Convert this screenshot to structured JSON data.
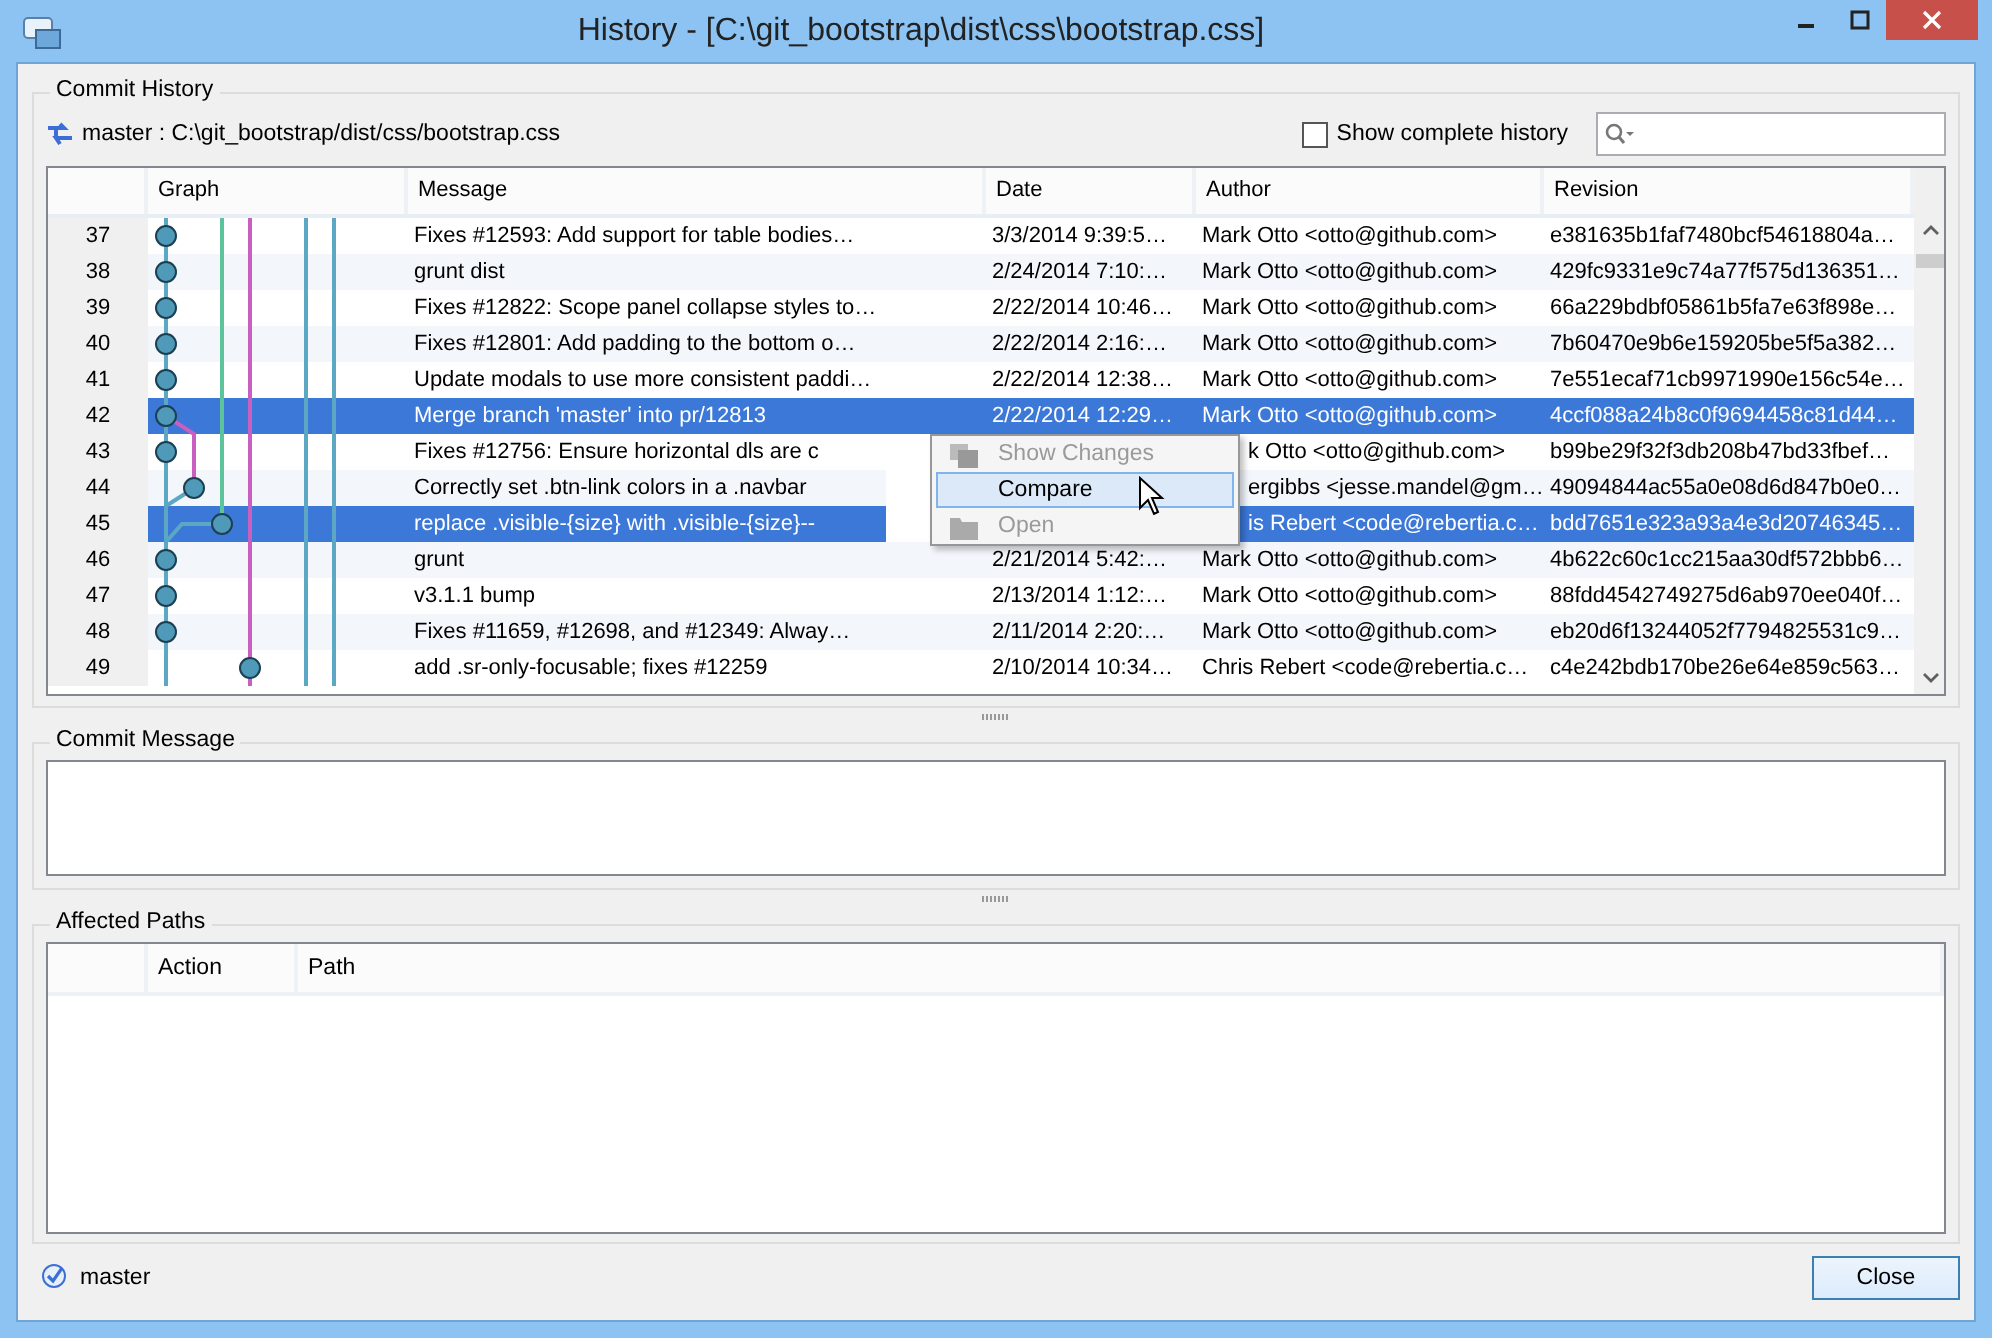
{
  "window": {
    "title": "History - [C:\\git_bootstrap\\dist\\css\\bootstrap.css]"
  },
  "commit_history": {
    "title": "Commit History",
    "branch_path": "master : C:\\git_bootstrap/dist/css/bootstrap.css",
    "show_complete_history": {
      "label": "Show complete history",
      "checked": false
    },
    "table": {
      "columns": [
        "Graph",
        "Message",
        "Date",
        "Author",
        "Revision"
      ],
      "rows": [
        {
          "number": "37",
          "message": "Fixes #12593: Add support for table bodies…",
          "date": "3/3/2014 9:39:5…",
          "author": "Mark Otto <otto@github.com>",
          "revision": "e381635b1faf7480bcf54618804a…",
          "selected": false
        },
        {
          "number": "38",
          "message": "grunt dist",
          "date": "2/24/2014 7:10:…",
          "author": "Mark Otto <otto@github.com>",
          "revision": "429fc9331e9c74a77f575d136351…",
          "selected": false
        },
        {
          "number": "39",
          "message": "Fixes #12822: Scope panel collapse styles to…",
          "date": "2/22/2014 10:46…",
          "author": "Mark Otto <otto@github.com>",
          "revision": "66a229bdbf05861b5fa7e63f898e…",
          "selected": false
        },
        {
          "number": "40",
          "message": "Fixes #12801: Add padding to the bottom o…",
          "date": "2/22/2014 2:16:…",
          "author": "Mark Otto <otto@github.com>",
          "revision": "7b60470e9b6e159205be5f5a382…",
          "selected": false
        },
        {
          "number": "41",
          "message": "Update modals to use more consistent paddi…",
          "date": "2/22/2014 12:38…",
          "author": "Mark Otto <otto@github.com>",
          "revision": "7e551ecaf71cb9971990e156c54e…",
          "selected": false
        },
        {
          "number": "42",
          "message": "Merge branch 'master' into pr/12813",
          "date": "2/22/2014 12:29…",
          "author": "Mark Otto <otto@github.com>",
          "revision": "4ccf088a24b8c0f9694458c81d44…",
          "selected": true
        },
        {
          "number": "43",
          "message": "Fixes #12756: Ensure horizontal dls are c",
          "author": "k Otto <otto@github.com>",
          "revision": "b99be29f32f3db208b47bd33fbef…",
          "selected": false,
          "covered": true
        },
        {
          "number": "44",
          "message": "Correctly set .btn-link colors in a .navbar",
          "author": "ergibbs <jesse.mandel@gm…",
          "revision": "49094844ac55a0e08d6d847b0e0…",
          "selected": false,
          "covered": true
        },
        {
          "number": "45",
          "message": "replace .visible-{size} with .visible-{size}--",
          "author": "is Rebert <code@rebertia.c…",
          "revision": "bdd7651e323a93a4e3d20746345…",
          "selected": true,
          "covered": true
        },
        {
          "number": "46",
          "message": "grunt",
          "date": "2/21/2014 5:42:…",
          "author": "Mark Otto <otto@github.com>",
          "revision": "4b622c60c1cc215aa30df572bbb6…",
          "selected": false
        },
        {
          "number": "47",
          "message": "v3.1.1 bump",
          "date": "2/13/2014 1:12:…",
          "author": "Mark Otto <otto@github.com>",
          "revision": "88fdd4542749275d6ab970ee040f…",
          "selected": false
        },
        {
          "number": "48",
          "message": "Fixes #11659, #12698, and #12349: Alway…",
          "date": "2/11/2014 2:20:…",
          "author": "Mark Otto <otto@github.com>",
          "revision": "eb20d6f13244052f7794825531c9…",
          "selected": false
        },
        {
          "number": "49",
          "message": "add .sr-only-focusable; fixes #12259",
          "date": "2/10/2014 10:34…",
          "author": "Chris Rebert <code@rebertia.c…",
          "revision": "c4e242bdb170be26e64e859c563…",
          "selected": false
        }
      ]
    },
    "context_menu": [
      {
        "label": "Show Changes",
        "disabled": true,
        "selected": false
      },
      {
        "label": "Compare",
        "disabled": false,
        "selected": true
      },
      {
        "label": "Open",
        "disabled": true,
        "selected": false
      }
    ]
  },
  "commit_message": {
    "title": "Commit Message"
  },
  "affected_paths": {
    "title": "Affected Paths",
    "columns": [
      "Action",
      "Path"
    ]
  },
  "status": {
    "branch": "master"
  },
  "buttons": [
    "Close"
  ]
}
